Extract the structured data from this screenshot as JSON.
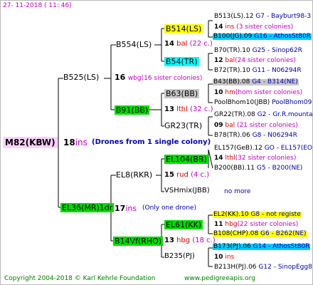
{
  "header": {
    "date": "27-  11-2018  (  11:  46)"
  },
  "root": {
    "name": "M82(KBW)",
    "year": "18",
    "code": "ins",
    "note": "(Drones from 1 single colony)"
  },
  "gen1": [
    {
      "name": "B525(LS)"
    },
    {
      "name": "EL36(MR)1dr",
      "year": "17",
      "code": "ins",
      "note": "(Only one drone)"
    }
  ],
  "gen2": [
    {
      "name": "B554(LS)",
      "year": "16",
      "code": "wbg",
      "note": "(16 sister colonies)"
    },
    {
      "name": "B91(BB)"
    },
    {
      "name": "EL8(RKR)"
    },
    {
      "name": "B14Vf(RHO)"
    }
  ],
  "gen3": [
    {
      "name": "B514(LS)"
    },
    {
      "year": "14",
      "code": "bal",
      "note": "(22 c.)"
    },
    {
      "name": "B54(TR)"
    },
    {
      "name": "B63(BB)"
    },
    {
      "year": "13",
      "code": "lthl",
      "note": "(32 c.)"
    },
    {
      "name": "GR23(TR)"
    },
    {
      "name": "EL104(BB)"
    },
    {
      "year": "15",
      "code": "rud",
      "note": "(4 c.)"
    },
    {
      "name": "VSHmix(JBB)"
    },
    {
      "name": "EL61(KK)"
    },
    {
      "year": "13",
      "code": "hbg",
      "note": "(18 c.)"
    },
    {
      "name": "B235(PJ)"
    }
  ],
  "gen4": [
    {
      "name": "B513(LS).12",
      "info": "G7 - Bayburt98-3"
    },
    {
      "name": "14",
      "info": "ins",
      "extra": "(3 sister colonies)"
    },
    {
      "name": "B100(JG).09",
      "info": "G16 - AthosSt80R"
    },
    {
      "name": "B70(TR).10",
      "info": "G25 - Sinop62R"
    },
    {
      "name": "12",
      "info": "bal",
      "extra": "(24 sister colonies)"
    },
    {
      "name": "B72(TR).10",
      "info": "G11 - N06294R"
    },
    {
      "name": "B43(BB).08",
      "info": "G4 - B314(NE)"
    },
    {
      "name": "10",
      "info": "hm",
      "extra": "(hom sister colonies)"
    },
    {
      "name": "PoolBhom10(JBB)",
      "info": "PoolBhom09(FK)+3"
    },
    {
      "name": "GR22(TR).08",
      "info": "G2 - Gr.R.mounta"
    },
    {
      "name": "09",
      "info": "bal",
      "extra": "(21 sister colonies)"
    },
    {
      "name": "B78(TR).06",
      "info": "G8 - N06294R"
    },
    {
      "name": "EL157(GeB).12",
      "info": "GO - EL157(EO)"
    },
    {
      "name": "14",
      "info": "lthl",
      "extra": "(32 sister colonies)"
    },
    {
      "name": "B200(BB).11",
      "info": "G5 - B200(NE)"
    },
    {
      "name": "no more"
    },
    {
      "name": "EL2(KK).10",
      "info": "G8 - not registe"
    },
    {
      "name": "11",
      "info": "hbg",
      "extra": "(22 sister colonies)"
    },
    {
      "name": "B108(CHP).08",
      "info": "G6 - B262(NE)"
    },
    {
      "name": "B173(PJ).06",
      "info": "G14 - AthosSt80R"
    },
    {
      "name": "10",
      "info": "ins"
    },
    {
      "name": "B213H(PJ).06",
      "info": "G12 - SinopEgg86R"
    }
  ],
  "footer": {
    "copyright": "Copyright 2004-2018 © Karl Kehrle Foundation",
    "site": "www.pedigreeapis.org"
  }
}
